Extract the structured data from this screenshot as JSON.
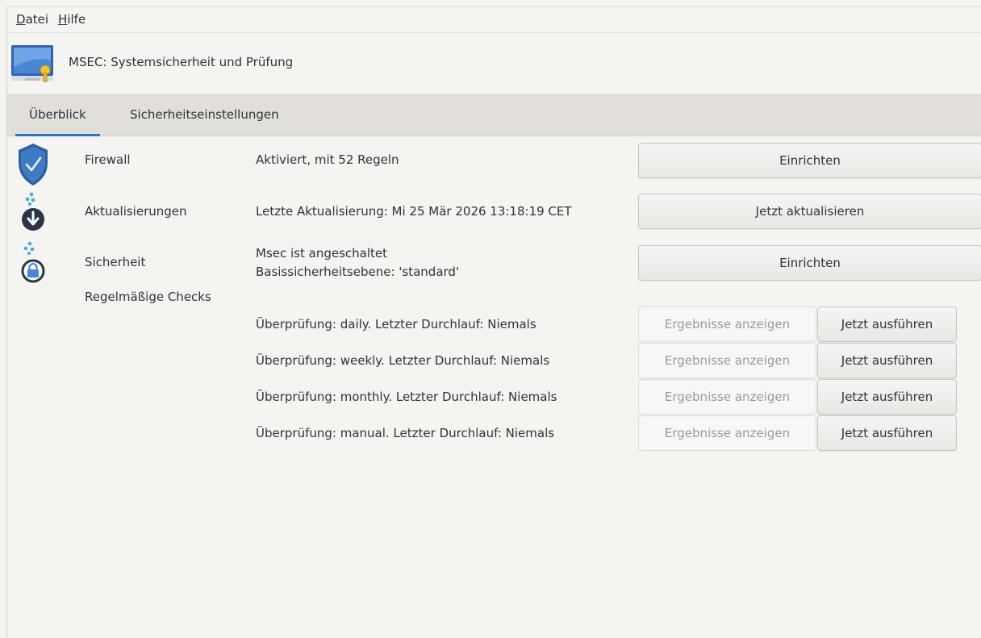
{
  "menubar": {
    "items": [
      {
        "mnemonic": "D",
        "rest": "atei"
      },
      {
        "mnemonic": "H",
        "rest": "ilfe"
      }
    ]
  },
  "header": {
    "title": "MSEC: Systemsicherheit und Prüfung",
    "icon": "monitor-lock-icon"
  },
  "tabs": [
    {
      "label": "Überblick",
      "active": true
    },
    {
      "label": "Sicherheitseinstellungen",
      "active": false
    }
  ],
  "overview": {
    "firewall": {
      "icon": "shield-check-icon",
      "label": "Firewall",
      "status": "Aktiviert, mit 52 Regeln",
      "button": "Einrichten"
    },
    "updates": {
      "icon": "download-icon",
      "label": "Aktualisierungen",
      "status": "Letzte Aktualisierung: Mi 25 Mär 2026 13:18:19 CET",
      "button": "Jetzt aktualisieren"
    },
    "security": {
      "icon": "lock-icon",
      "label": "Sicherheit",
      "status_line1": "Msec ist angeschaltet",
      "status_line2": "Basissicherheitsebene: 'standard'",
      "button": "Einrichten"
    },
    "checks": {
      "label": "Regelmäßige Checks",
      "items": [
        {
          "text": "Überprüfung: daily. Letzter Durchlauf: Niemals",
          "results_button": "Ergebnisse anzeigen",
          "run_button": "Jetzt ausführen"
        },
        {
          "text": "Überprüfung: weekly. Letzter Durchlauf: Niemals",
          "results_button": "Ergebnisse anzeigen",
          "run_button": "Jetzt ausführen"
        },
        {
          "text": "Überprüfung: monthly. Letzter Durchlauf: Niemals",
          "results_button": "Ergebnisse anzeigen",
          "run_button": "Jetzt ausführen"
        },
        {
          "text": "Überprüfung: manual. Letzter Durchlauf: Niemals",
          "results_button": "Ergebnisse anzeigen",
          "run_button": "Jetzt ausführen"
        }
      ]
    }
  },
  "colors": {
    "accent": "#2a76c6",
    "tabbar": "#e2dfdb",
    "background": "#f4f4f1"
  }
}
